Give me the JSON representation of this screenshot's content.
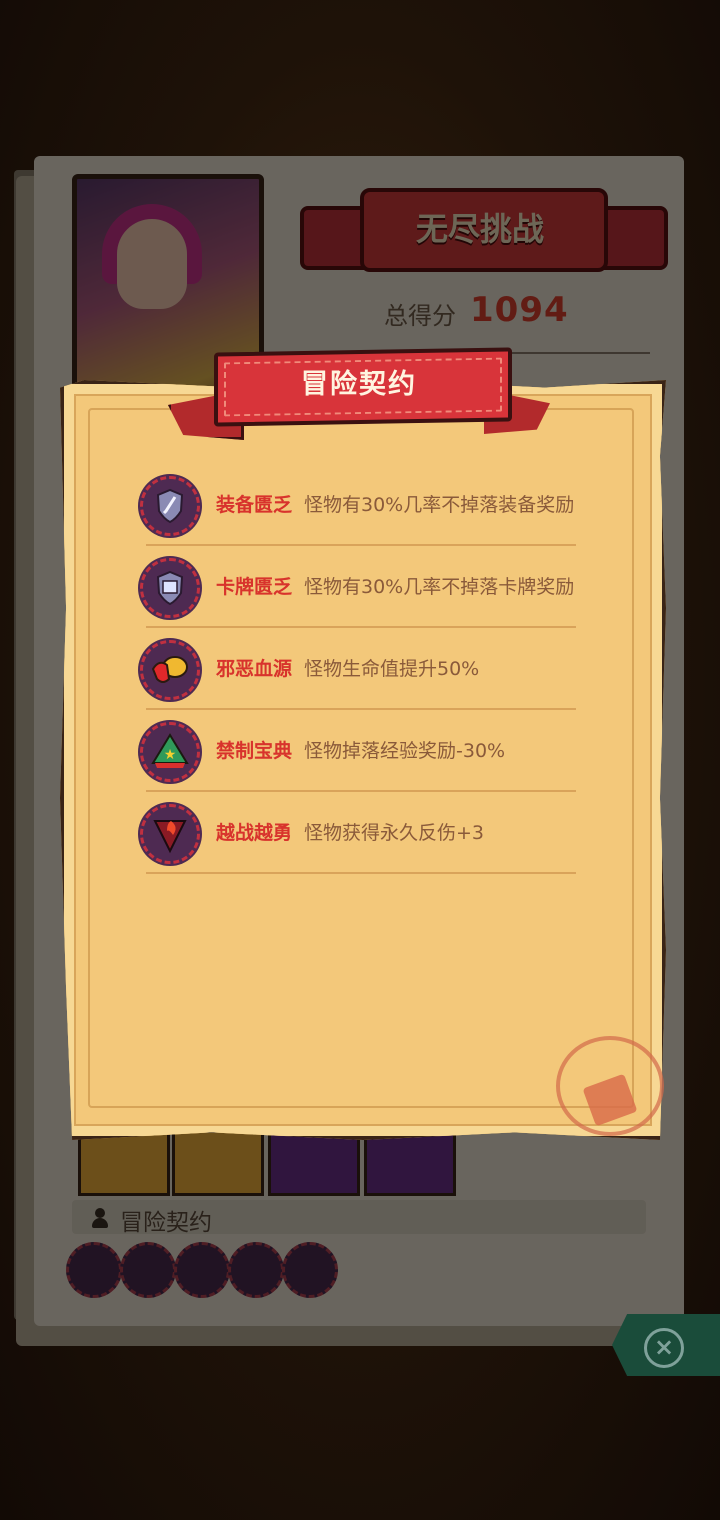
{
  "background_panel": {
    "mode_title": "无尽挑战",
    "score_label": "总得分",
    "score_value": "1094",
    "contracts_section_label": "冒险契约"
  },
  "dialog": {
    "title": "冒险契约",
    "items": [
      {
        "name": "装备匮乏",
        "desc": "怪物有30%几率不掉落装备奖励",
        "icon": "shield-sword-icon"
      },
      {
        "name": "卡牌匮乏",
        "desc": "怪物有30%几率不掉落卡牌奖励",
        "icon": "shield-card-icon"
      },
      {
        "name": "邪恶血源",
        "desc": "怪物生命值提升50%",
        "icon": "blood-gold-icon"
      },
      {
        "name": "禁制宝典",
        "desc": "怪物掉落经验奖励-30%",
        "icon": "star-tome-icon"
      },
      {
        "name": "越战越勇",
        "desc": "怪物获得永久反伤+3",
        "icon": "flame-shield-icon"
      }
    ]
  },
  "colors": {
    "accent_red": "#d8332c",
    "scroll_bg": "#f3c87a",
    "desc_brown": "#8a5a3a",
    "close_green": "#2f8a6a"
  }
}
